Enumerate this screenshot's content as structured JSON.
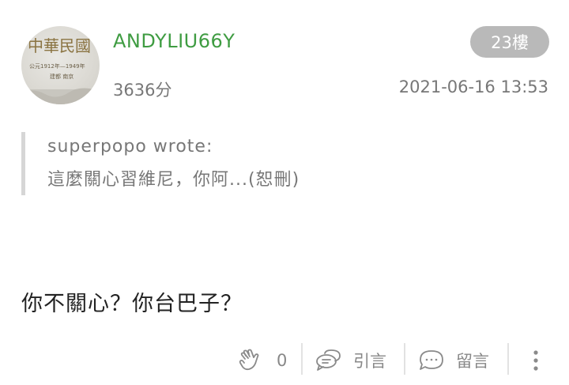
{
  "post": {
    "username": "ANDYLIU66Y",
    "floor": "23樓",
    "score": "3636分",
    "timestamp": "2021-06-16 13:53",
    "quote": {
      "author": "superpopo wrote:",
      "text": "這麼關心習維尼，你阿...(恕刪)"
    },
    "body": "你不關心？你台巴子？"
  },
  "avatar": {
    "title": "中華民國",
    "line1": "公元1912年—1949年",
    "line2": "建都 南京"
  },
  "actions": {
    "like_count": "0",
    "quote_label": "引言",
    "comment_label": "留言"
  },
  "colors": {
    "username": "#3f9c42",
    "badge": "#b9b9b9",
    "muted_text": "#777777",
    "quote_bar": "#d6d6d6"
  }
}
